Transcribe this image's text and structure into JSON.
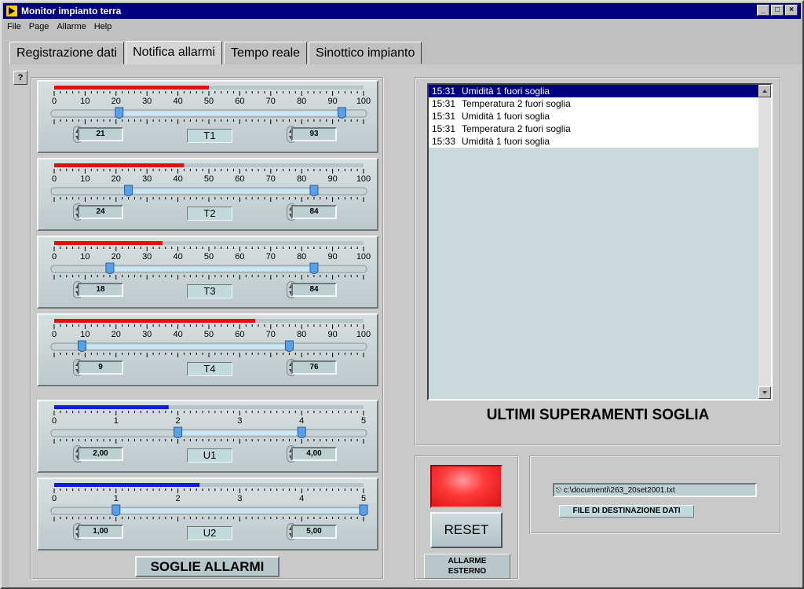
{
  "window": {
    "title": "Monitor impianto terra",
    "controls": [
      "minimize-icon",
      "maximize-icon",
      "close-icon"
    ]
  },
  "menu": [
    "File",
    "Page",
    "Allarme",
    "Help"
  ],
  "tabs": [
    {
      "label": "Registrazione dati",
      "active": false
    },
    {
      "label": "Notifica allarmi",
      "active": true
    },
    {
      "label": "Tempo reale",
      "active": false
    },
    {
      "label": "Sinottico impianto",
      "active": false
    }
  ],
  "help_button": "?",
  "sliders": [
    {
      "name": "T1",
      "min": 0,
      "max": 100,
      "ticks": [
        "0",
        "10",
        "20",
        "30",
        "40",
        "50",
        "60",
        "70",
        "80",
        "90",
        "100"
      ],
      "current": 50,
      "low": "21",
      "high": "93",
      "low_value": 21,
      "high_value": 93,
      "color": "#e01010"
    },
    {
      "name": "T2",
      "min": 0,
      "max": 100,
      "ticks": [
        "0",
        "10",
        "20",
        "30",
        "40",
        "50",
        "60",
        "70",
        "80",
        "90",
        "100"
      ],
      "current": 42,
      "low": "24",
      "high": "84",
      "low_value": 24,
      "high_value": 84,
      "color": "#e01010"
    },
    {
      "name": "T3",
      "min": 0,
      "max": 100,
      "ticks": [
        "0",
        "10",
        "20",
        "30",
        "40",
        "50",
        "60",
        "70",
        "80",
        "90",
        "100"
      ],
      "current": 35,
      "low": "18",
      "high": "84",
      "low_value": 18,
      "high_value": 84,
      "color": "#e01010"
    },
    {
      "name": "T4",
      "min": 0,
      "max": 100,
      "ticks": [
        "0",
        "10",
        "20",
        "30",
        "40",
        "50",
        "60",
        "70",
        "80",
        "90",
        "100"
      ],
      "current": 65,
      "low": "9",
      "high": "76",
      "low_value": 9,
      "high_value": 76,
      "color": "#e01010"
    },
    {
      "name": "U1",
      "min": 0,
      "max": 5,
      "ticks": [
        "0",
        "1",
        "2",
        "3",
        "4",
        "5"
      ],
      "current": 1.85,
      "low": "2,00",
      "high": "4,00",
      "low_value": 2,
      "high_value": 4,
      "color": "#1020d0"
    },
    {
      "name": "U2",
      "min": 0,
      "max": 5,
      "ticks": [
        "0",
        "1",
        "2",
        "3",
        "4",
        "5"
      ],
      "current": 2.35,
      "low": "1,00",
      "high": "5,00",
      "low_value": 1,
      "high_value": 5,
      "color": "#1020d0"
    }
  ],
  "soglie_label": "SOGLIE ALLARMI",
  "log": [
    {
      "time": "15:31",
      "text": "Umidità 1 fuori soglia",
      "selected": true
    },
    {
      "time": "15:31",
      "text": "Temperatura 2 fuori soglia",
      "selected": false
    },
    {
      "time": "15:31",
      "text": "Umidità 1 fuori soglia",
      "selected": false
    },
    {
      "time": "15:31",
      "text": "Temperatura 2 fuori soglia",
      "selected": false
    },
    {
      "time": "15:33",
      "text": "Umidità 1 fuori soglia",
      "selected": false
    }
  ],
  "log_title": "ULTIMI SUPERAMENTI SOGLIA",
  "reset_label": "RESET",
  "allarme_label_1": "ALLARME",
  "allarme_label_2": "ESTERNO",
  "file_path": "c:\\documenti\\263_20set2001.txt",
  "file_label": "FILE DI DESTINAZIONE DATI"
}
